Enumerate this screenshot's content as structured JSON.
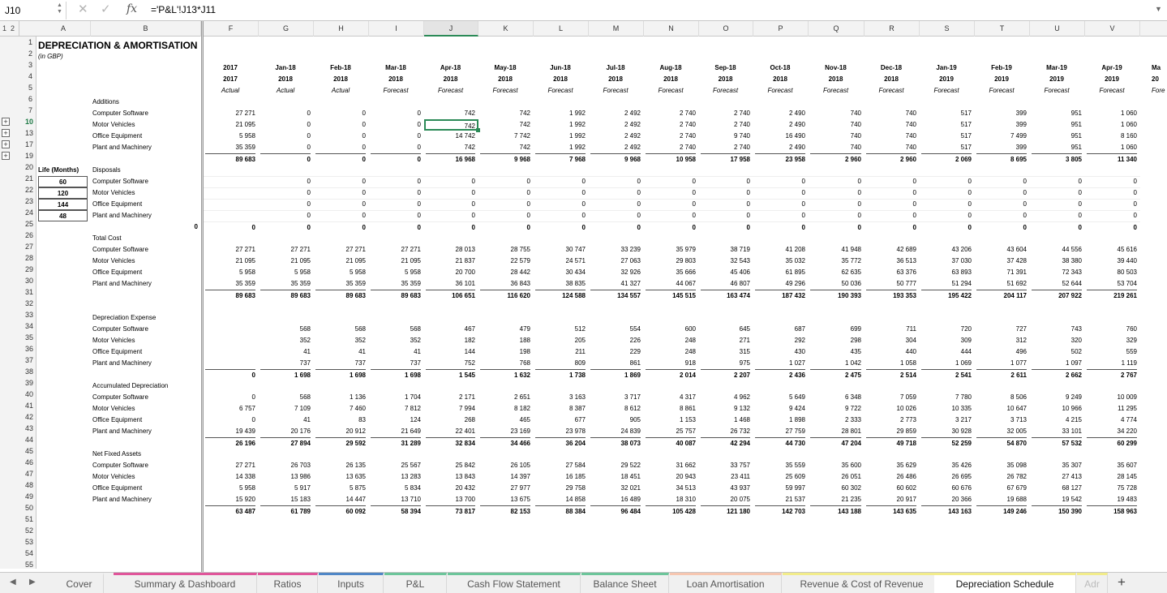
{
  "formula_bar": {
    "cell_ref": "J10",
    "fx_label": "fx",
    "formula": "='P&L'!J13*J11",
    "cancel_icon": "x-icon",
    "confirm_icon": "check-icon"
  },
  "outline_levels": [
    "1",
    "2"
  ],
  "columns": [
    "A",
    "B",
    "F",
    "G",
    "H",
    "I",
    "J",
    "K",
    "L",
    "M",
    "N",
    "O",
    "P",
    "Q",
    "R",
    "S",
    "T",
    "U",
    "V"
  ],
  "selected_column": "J",
  "row_numbers": [
    "1",
    "2",
    "3",
    "4",
    "5",
    "6",
    "7",
    "10",
    "13",
    "17",
    "19",
    "20",
    "21",
    "22",
    "23",
    "24",
    "25",
    "26",
    "27",
    "28",
    "29",
    "30",
    "31",
    "32",
    "33",
    "34",
    "35",
    "36",
    "37",
    "38",
    "39",
    "40",
    "41",
    "42",
    "43",
    "44",
    "45",
    "46",
    "47",
    "48",
    "49",
    "50",
    "51",
    "52",
    "53",
    "54",
    "55"
  ],
  "selected_row": "10",
  "sheet": {
    "title": "DEPRECIATION & AMORTISATION",
    "subtitle": "(in GBP)",
    "life_header": "Life (Months)",
    "periods": [
      [
        "2017",
        "2017",
        "Actual"
      ],
      [
        "Jan-18",
        "2018",
        "Actual"
      ],
      [
        "Feb-18",
        "2018",
        "Actual"
      ],
      [
        "Mar-18",
        "2018",
        "Forecast"
      ],
      [
        "Apr-18",
        "2018",
        "Forecast"
      ],
      [
        "May-18",
        "2018",
        "Forecast"
      ],
      [
        "Jun-18",
        "2018",
        "Forecast"
      ],
      [
        "Jul-18",
        "2018",
        "Forecast"
      ],
      [
        "Aug-18",
        "2018",
        "Forecast"
      ],
      [
        "Sep-18",
        "2018",
        "Forecast"
      ],
      [
        "Oct-18",
        "2018",
        "Forecast"
      ],
      [
        "Nov-18",
        "2018",
        "Forecast"
      ],
      [
        "Dec-18",
        "2018",
        "Forecast"
      ],
      [
        "Jan-19",
        "2019",
        "Forecast"
      ],
      [
        "Feb-19",
        "2019",
        "Forecast"
      ],
      [
        "Mar-19",
        "2019",
        "Forecast"
      ],
      [
        "Apr-19",
        "2019",
        "Forecast"
      ],
      [
        "Ma",
        "20",
        "Fore"
      ]
    ],
    "sections": [
      {
        "header": "Additions",
        "items": [
          "Computer Software",
          "Motor Vehicles",
          "Office Equipment",
          "Plant and Machinery"
        ],
        "values": [
          [
            "27 271",
            "0",
            "0",
            "0",
            "742",
            "742",
            "1 992",
            "2 492",
            "2 740",
            "2 740",
            "2 490",
            "740",
            "740",
            "517",
            "399",
            "951",
            "1 060"
          ],
          [
            "21 095",
            "0",
            "0",
            "0",
            "742",
            "742",
            "1 992",
            "2 492",
            "2 740",
            "2 740",
            "2 490",
            "740",
            "740",
            "517",
            "399",
            "951",
            "1 060"
          ],
          [
            "5 958",
            "0",
            "0",
            "0",
            "14 742",
            "7 742",
            "1 992",
            "2 492",
            "2 740",
            "9 740",
            "16 490",
            "740",
            "740",
            "517",
            "7 499",
            "951",
            "8 160"
          ],
          [
            "35 359",
            "0",
            "0",
            "0",
            "742",
            "742",
            "1 992",
            "2 492",
            "2 740",
            "2 740",
            "2 490",
            "740",
            "740",
            "517",
            "399",
            "951",
            "1 060"
          ]
        ],
        "total": [
          "89 683",
          "0",
          "0",
          "0",
          "16 968",
          "9 968",
          "7 968",
          "9 968",
          "10 958",
          "17 958",
          "23 958",
          "2 960",
          "2 960",
          "2 069",
          "8 695",
          "3 805",
          "11 340"
        ]
      },
      {
        "header": "Disposals",
        "items": [
          "Computer Software",
          "Motor Vehicles",
          "Office Equipment",
          "Plant and Machinery"
        ],
        "life": [
          "60",
          "120",
          "144",
          "48"
        ],
        "values": [
          [
            "",
            "0",
            "0",
            "0",
            "0",
            "0",
            "0",
            "0",
            "0",
            "0",
            "0",
            "0",
            "0",
            "0",
            "0",
            "0",
            "0"
          ],
          [
            "",
            "0",
            "0",
            "0",
            "0",
            "0",
            "0",
            "0",
            "0",
            "0",
            "0",
            "0",
            "0",
            "0",
            "0",
            "0",
            "0"
          ],
          [
            "",
            "0",
            "0",
            "0",
            "0",
            "0",
            "0",
            "0",
            "0",
            "0",
            "0",
            "0",
            "0",
            "0",
            "0",
            "0",
            "0"
          ],
          [
            "",
            "0",
            "0",
            "0",
            "0",
            "0",
            "0",
            "0",
            "0",
            "0",
            "0",
            "0",
            "0",
            "0",
            "0",
            "0",
            "0"
          ]
        ],
        "total": [
          "0",
          "0",
          "0",
          "0",
          "0",
          "0",
          "0",
          "0",
          "0",
          "0",
          "0",
          "0",
          "0",
          "0",
          "0",
          "0",
          "0"
        ],
        "total_col_e": "0"
      },
      {
        "header": "Total Cost",
        "items": [
          "Computer Software",
          "Motor Vehicles",
          "Office Equipment",
          "Plant and Machinery"
        ],
        "values": [
          [
            "27 271",
            "27 271",
            "27 271",
            "27 271",
            "28 013",
            "28 755",
            "30 747",
            "33 239",
            "35 979",
            "38 719",
            "41 208",
            "41 948",
            "42 689",
            "43 206",
            "43 604",
            "44 556",
            "45 616"
          ],
          [
            "21 095",
            "21 095",
            "21 095",
            "21 095",
            "21 837",
            "22 579",
            "24 571",
            "27 063",
            "29 803",
            "32 543",
            "35 032",
            "35 772",
            "36 513",
            "37 030",
            "37 428",
            "38 380",
            "39 440"
          ],
          [
            "5 958",
            "5 958",
            "5 958",
            "5 958",
            "20 700",
            "28 442",
            "30 434",
            "32 926",
            "35 666",
            "45 406",
            "61 895",
            "62 635",
            "63 376",
            "63 893",
            "71 391",
            "72 343",
            "80 503"
          ],
          [
            "35 359",
            "35 359",
            "35 359",
            "35 359",
            "36 101",
            "36 843",
            "38 835",
            "41 327",
            "44 067",
            "46 807",
            "49 296",
            "50 036",
            "50 777",
            "51 294",
            "51 692",
            "52 644",
            "53 704"
          ]
        ],
        "total": [
          "89 683",
          "89 683",
          "89 683",
          "89 683",
          "106 651",
          "116 620",
          "124 588",
          "134 557",
          "145 515",
          "163 474",
          "187 432",
          "190 393",
          "193 353",
          "195 422",
          "204 117",
          "207 922",
          "219 261"
        ]
      },
      {
        "header": "Depreciation Expense",
        "items": [
          "Computer Software",
          "Motor Vehicles",
          "Office Equipment",
          "Plant and Machinery"
        ],
        "values": [
          [
            "",
            "568",
            "568",
            "568",
            "467",
            "479",
            "512",
            "554",
            "600",
            "645",
            "687",
            "699",
            "711",
            "720",
            "727",
            "743",
            "760"
          ],
          [
            "",
            "352",
            "352",
            "352",
            "182",
            "188",
            "205",
            "226",
            "248",
            "271",
            "292",
            "298",
            "304",
            "309",
            "312",
            "320",
            "329"
          ],
          [
            "",
            "41",
            "41",
            "41",
            "144",
            "198",
            "211",
            "229",
            "248",
            "315",
            "430",
            "435",
            "440",
            "444",
            "496",
            "502",
            "559"
          ],
          [
            "",
            "737",
            "737",
            "737",
            "752",
            "768",
            "809",
            "861",
            "918",
            "975",
            "1 027",
            "1 042",
            "1 058",
            "1 069",
            "1 077",
            "1 097",
            "1 119"
          ]
        ],
        "total": [
          "0",
          "1 698",
          "1 698",
          "1 698",
          "1 545",
          "1 632",
          "1 738",
          "1 869",
          "2 014",
          "2 207",
          "2 436",
          "2 475",
          "2 514",
          "2 541",
          "2 611",
          "2 662",
          "2 767"
        ]
      },
      {
        "header": "Accumulated Depreciation",
        "items": [
          "Computer Software",
          "Motor Vehicles",
          "Office Equipment",
          "Plant and Machinery"
        ],
        "values": [
          [
            "0",
            "568",
            "1 136",
            "1 704",
            "2 171",
            "2 651",
            "3 163",
            "3 717",
            "4 317",
            "4 962",
            "5 649",
            "6 348",
            "7 059",
            "7 780",
            "8 506",
            "9 249",
            "10 009"
          ],
          [
            "6 757",
            "7 109",
            "7 460",
            "7 812",
            "7 994",
            "8 182",
            "8 387",
            "8 612",
            "8 861",
            "9 132",
            "9 424",
            "9 722",
            "10 026",
            "10 335",
            "10 647",
            "10 966",
            "11 295"
          ],
          [
            "0",
            "41",
            "83",
            "124",
            "268",
            "465",
            "677",
            "905",
            "1 153",
            "1 468",
            "1 898",
            "2 333",
            "2 773",
            "3 217",
            "3 713",
            "4 215",
            "4 774"
          ],
          [
            "19 439",
            "20 176",
            "20 912",
            "21 649",
            "22 401",
            "23 169",
            "23 978",
            "24 839",
            "25 757",
            "26 732",
            "27 759",
            "28 801",
            "29 859",
            "30 928",
            "32 005",
            "33 101",
            "34 220"
          ]
        ],
        "total": [
          "26 196",
          "27 894",
          "29 592",
          "31 289",
          "32 834",
          "34 466",
          "36 204",
          "38 073",
          "40 087",
          "42 294",
          "44 730",
          "47 204",
          "49 718",
          "52 259",
          "54 870",
          "57 532",
          "60 299"
        ]
      },
      {
        "header": "Net Fixed Assets",
        "items": [
          "Computer Software",
          "Motor Vehicles",
          "Office Equipment",
          "Plant and Machinery"
        ],
        "values": [
          [
            "27 271",
            "26 703",
            "26 135",
            "25 567",
            "25 842",
            "26 105",
            "27 584",
            "29 522",
            "31 662",
            "33 757",
            "35 559",
            "35 600",
            "35 629",
            "35 426",
            "35 098",
            "35 307",
            "35 607"
          ],
          [
            "14 338",
            "13 986",
            "13 635",
            "13 283",
            "13 843",
            "14 397",
            "16 185",
            "18 451",
            "20 943",
            "23 411",
            "25 609",
            "26 051",
            "26 486",
            "26 695",
            "26 782",
            "27 413",
            "28 145"
          ],
          [
            "5 958",
            "5 917",
            "5 875",
            "5 834",
            "20 432",
            "27 977",
            "29 758",
            "32 021",
            "34 513",
            "43 937",
            "59 997",
            "60 302",
            "60 602",
            "60 676",
            "67 679",
            "68 127",
            "75 728"
          ],
          [
            "15 920",
            "15 183",
            "14 447",
            "13 710",
            "13 700",
            "13 675",
            "14 858",
            "16 489",
            "18 310",
            "20 075",
            "21 537",
            "21 235",
            "20 917",
            "20 366",
            "19 688",
            "19 542",
            "19 483"
          ]
        ],
        "total": [
          "63 487",
          "61 789",
          "60 092",
          "58 394",
          "73 817",
          "82 153",
          "88 384",
          "96 484",
          "105 428",
          "121 180",
          "142 703",
          "143 188",
          "143 635",
          "143 163",
          "149 246",
          "150 390",
          "158 963"
        ]
      }
    ]
  },
  "tabs": [
    {
      "label": "Cover",
      "color": "#f0f0f0"
    },
    {
      "label": "Summary & Dashboard",
      "color": "#e0559a"
    },
    {
      "label": "Ratios",
      "color": "#e0559a"
    },
    {
      "label": "Inputs",
      "color": "#4f86c6"
    },
    {
      "label": "P&L",
      "color": "#6cc59a"
    },
    {
      "label": "Cash Flow Statement",
      "color": "#6cc59a"
    },
    {
      "label": "Balance Sheet",
      "color": "#6cc59a"
    },
    {
      "label": "Loan Amortisation",
      "color": "#f6c6b0"
    },
    {
      "label": "Revenue & Cost of Revenue",
      "color": "#f2ec8a"
    },
    {
      "label": "Depreciation Schedule",
      "color": "#f2ec8a",
      "active": true
    },
    {
      "label": "Adr",
      "color": "#f2ec8a"
    }
  ],
  "add_sheet_label": "+",
  "icons": {
    "prev": "triangle-left-icon",
    "next": "triangle-right-icon",
    "add": "plus-icon",
    "expand": "chevron-down-icon"
  }
}
